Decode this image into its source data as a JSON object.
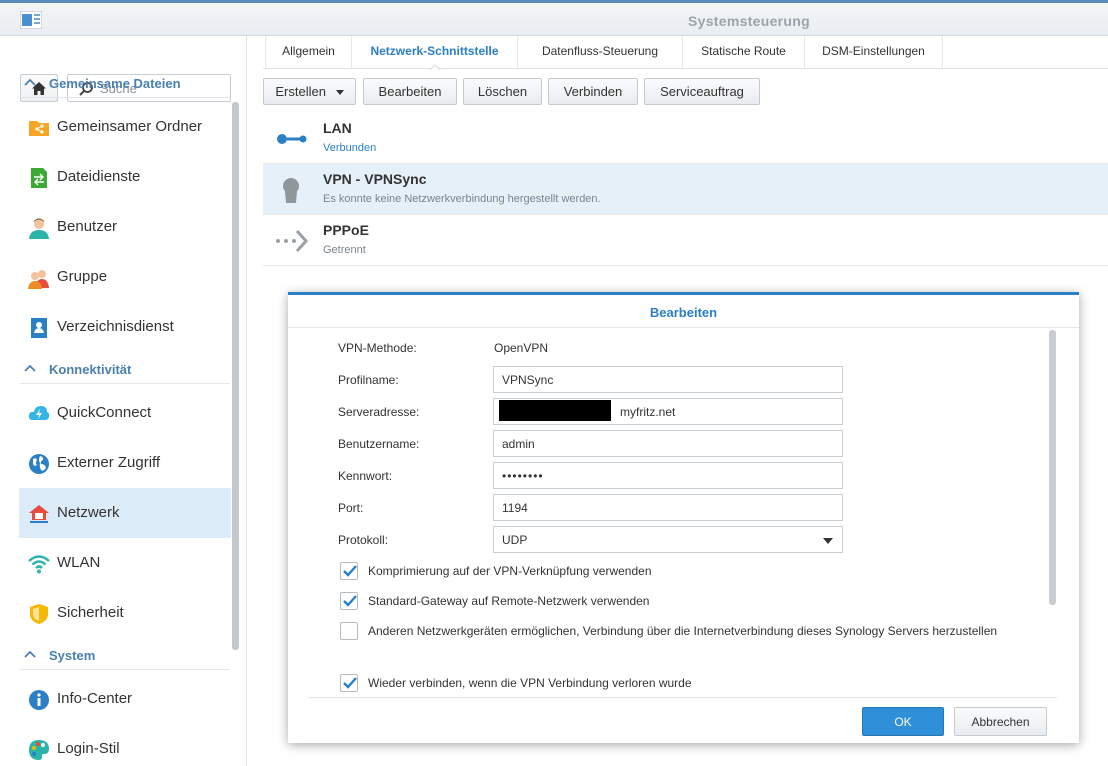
{
  "window": {
    "title": "Systemsteuerung"
  },
  "sidebar": {
    "search_placeholder": "Suche",
    "sections": [
      {
        "label": "Gemeinsame Dateien",
        "items": [
          {
            "label": "Gemeinsamer Ordner",
            "icon": "shared-folder-icon"
          },
          {
            "label": "Dateidienste",
            "icon": "file-services-icon"
          },
          {
            "label": "Benutzer",
            "icon": "user-icon"
          },
          {
            "label": "Gruppe",
            "icon": "group-icon"
          },
          {
            "label": "Verzeichnisdienst",
            "icon": "directory-icon"
          }
        ]
      },
      {
        "label": "Konnektivität",
        "items": [
          {
            "label": "QuickConnect",
            "icon": "quickconnect-icon"
          },
          {
            "label": "Externer Zugriff",
            "icon": "globe-icon"
          },
          {
            "label": "Netzwerk",
            "icon": "network-house-icon",
            "active": true
          },
          {
            "label": "WLAN",
            "icon": "wifi-icon"
          },
          {
            "label": "Sicherheit",
            "icon": "shield-icon"
          }
        ]
      },
      {
        "label": "System",
        "items": [
          {
            "label": "Info-Center",
            "icon": "info-icon"
          },
          {
            "label": "Login-Stil",
            "icon": "palette-icon"
          }
        ]
      }
    ]
  },
  "tabs": [
    "Allgemein",
    "Netzwerk-Schnittstelle",
    "Datenfluss-Steuerung",
    "Statische Route",
    "DSM-Einstellungen"
  ],
  "active_tab": "Netzwerk-Schnittstelle",
  "toolbar": {
    "create": "Erstellen",
    "edit": "Bearbeiten",
    "delete": "Löschen",
    "connect": "Verbinden",
    "service": "Serviceauftrag"
  },
  "interfaces": [
    {
      "name": "LAN",
      "status": "Verbunden",
      "icon": "lan-icon"
    },
    {
      "name": "VPN - VPNSync",
      "status": "Es konnte keine Netzwerkverbindung hergestellt werden.",
      "icon": "vpn-keyhole-icon",
      "selected": true
    },
    {
      "name": "PPPoE",
      "status": "Getrennt",
      "icon": "pppoe-icon"
    }
  ],
  "dialog": {
    "title": "Bearbeiten",
    "vpn_method_label": "VPN-Methode:",
    "vpn_method_value": "OpenVPN",
    "profile_label": "Profilname:",
    "profile_value": "VPNSync",
    "server_label": "Serveradresse:",
    "server_value_suffix": "myfritz.net",
    "username_label": "Benutzername:",
    "username_value": "admin",
    "password_label": "Kennwort:",
    "password_value": "••••••••",
    "port_label": "Port:",
    "port_value": "1194",
    "protocol_label": "Protokoll:",
    "protocol_value": "UDP",
    "checkboxes": [
      {
        "label": "Komprimierung auf der VPN-Verknüpfung verwenden",
        "checked": true
      },
      {
        "label": "Standard-Gateway auf Remote-Netzwerk verwenden",
        "checked": true
      },
      {
        "label": "Anderen Netzwerkgeräten ermöglichen, Verbindung über die Internetverbindung dieses Synology Servers herzustellen",
        "checked": false
      },
      {
        "label": "Wieder verbinden, wenn die VPN Verbindung verloren wurde",
        "checked": true
      }
    ],
    "ok": "OK",
    "cancel": "Abbrechen"
  },
  "colors": {
    "accent": "#2a7fc6",
    "selected_row": "#e6f0f8",
    "active_nav": "#dcebf8",
    "checkbox": "#2a7fc6"
  }
}
